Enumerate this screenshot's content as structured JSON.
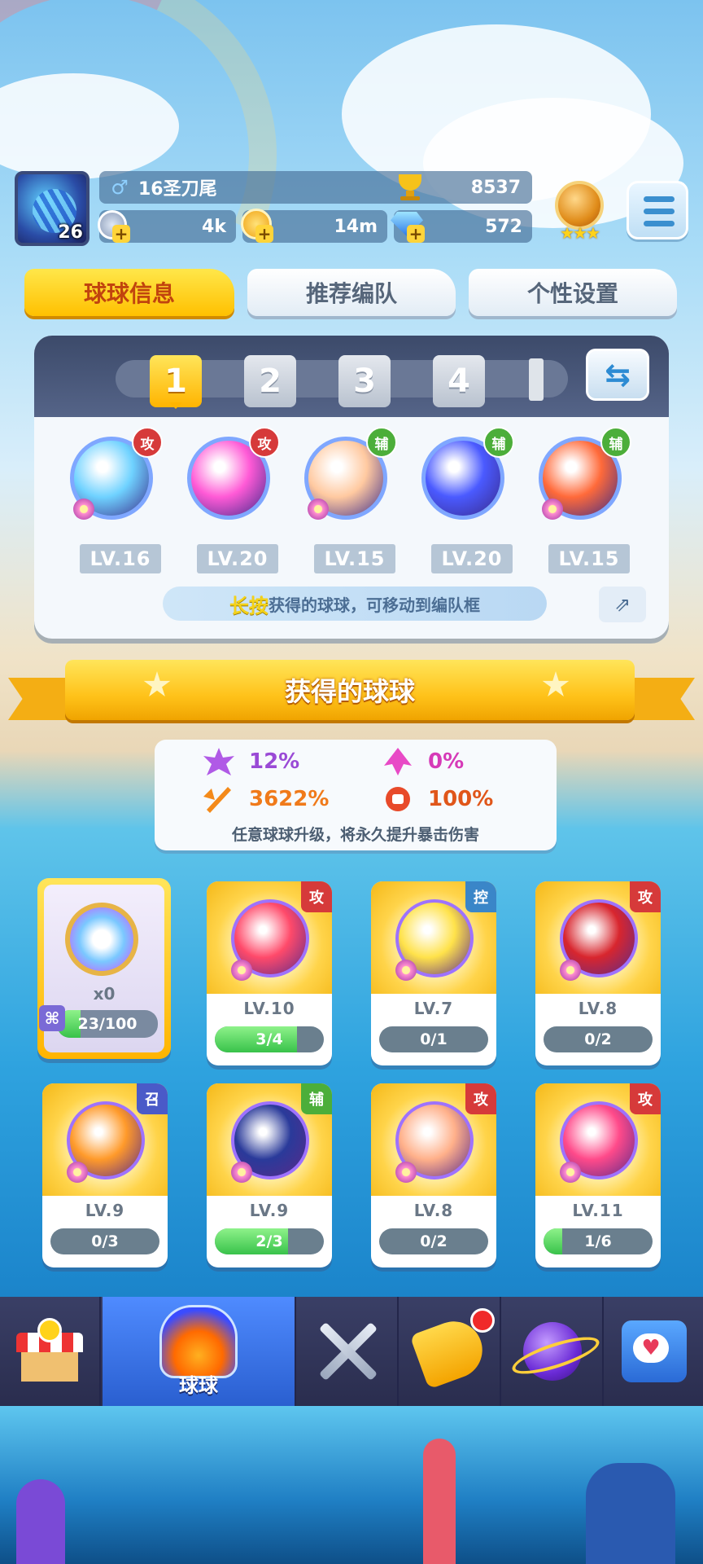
{
  "player": {
    "level": "26",
    "name": "16圣刀尾",
    "trophies": "8537",
    "gender": "♂"
  },
  "resources": {
    "energy": "4k",
    "coins": "14m",
    "gems": "572"
  },
  "tabs": [
    "球球信息",
    "推荐编队",
    "个性设置"
  ],
  "team": {
    "slots": [
      "1",
      "2",
      "3",
      "4"
    ],
    "active_slot": "1",
    "balls": [
      {
        "tag": "攻",
        "level": "LV.16",
        "color": "#6fd2ff"
      },
      {
        "tag": "攻",
        "level": "LV.20",
        "color": "#ff5ad6"
      },
      {
        "tag": "辅",
        "level": "LV.15",
        "color": "#ffc9a0"
      },
      {
        "tag": "辅",
        "level": "LV.20",
        "color": "#4a5aff"
      },
      {
        "tag": "辅",
        "level": "LV.15",
        "color": "#ff6a3a"
      }
    ],
    "hint_highlight": "长按",
    "hint_text": "获得的球球，可移动到编队框"
  },
  "section_title": "获得的球球",
  "stats": {
    "crit_rate": "12%",
    "crit_up": "0%",
    "crit_damage": "3622%",
    "crit_extra": "100%",
    "note": "任意球球升级，将永久提升暴击伤害"
  },
  "special_card": {
    "count": "x0",
    "progress": "23/100",
    "progress_value": 0.23
  },
  "cards": [
    {
      "tag": "攻",
      "level": "LV.10",
      "progress": "3/4",
      "progress_value": 0.75,
      "color": "#ff4a6a"
    },
    {
      "tag": "控",
      "level": "LV.7",
      "progress": "0/1",
      "progress_value": 0,
      "color": "#ffe24a"
    },
    {
      "tag": "攻",
      "level": "LV.8",
      "progress": "0/2",
      "progress_value": 0,
      "color": "#d8262e"
    },
    {
      "tag": "召",
      "level": "LV.9",
      "progress": "0/3",
      "progress_value": 0,
      "color": "#ff9a2a"
    },
    {
      "tag": "辅",
      "level": "LV.9",
      "progress": "2/3",
      "progress_value": 0.67,
      "color": "#2a3a9a"
    },
    {
      "tag": "攻",
      "level": "LV.8",
      "progress": "0/2",
      "progress_value": 0,
      "color": "#ffb08a"
    },
    {
      "tag": "攻",
      "level": "LV.11",
      "progress": "1/6",
      "progress_value": 0.17,
      "color": "#ff4a8a"
    }
  ],
  "nav": {
    "active_label": "球球"
  },
  "colors": {
    "accent": "#ffc000",
    "attack": "#d63a3a",
    "support": "#4cae3a",
    "control": "#3a86c8",
    "summon": "#4a5ac8"
  }
}
